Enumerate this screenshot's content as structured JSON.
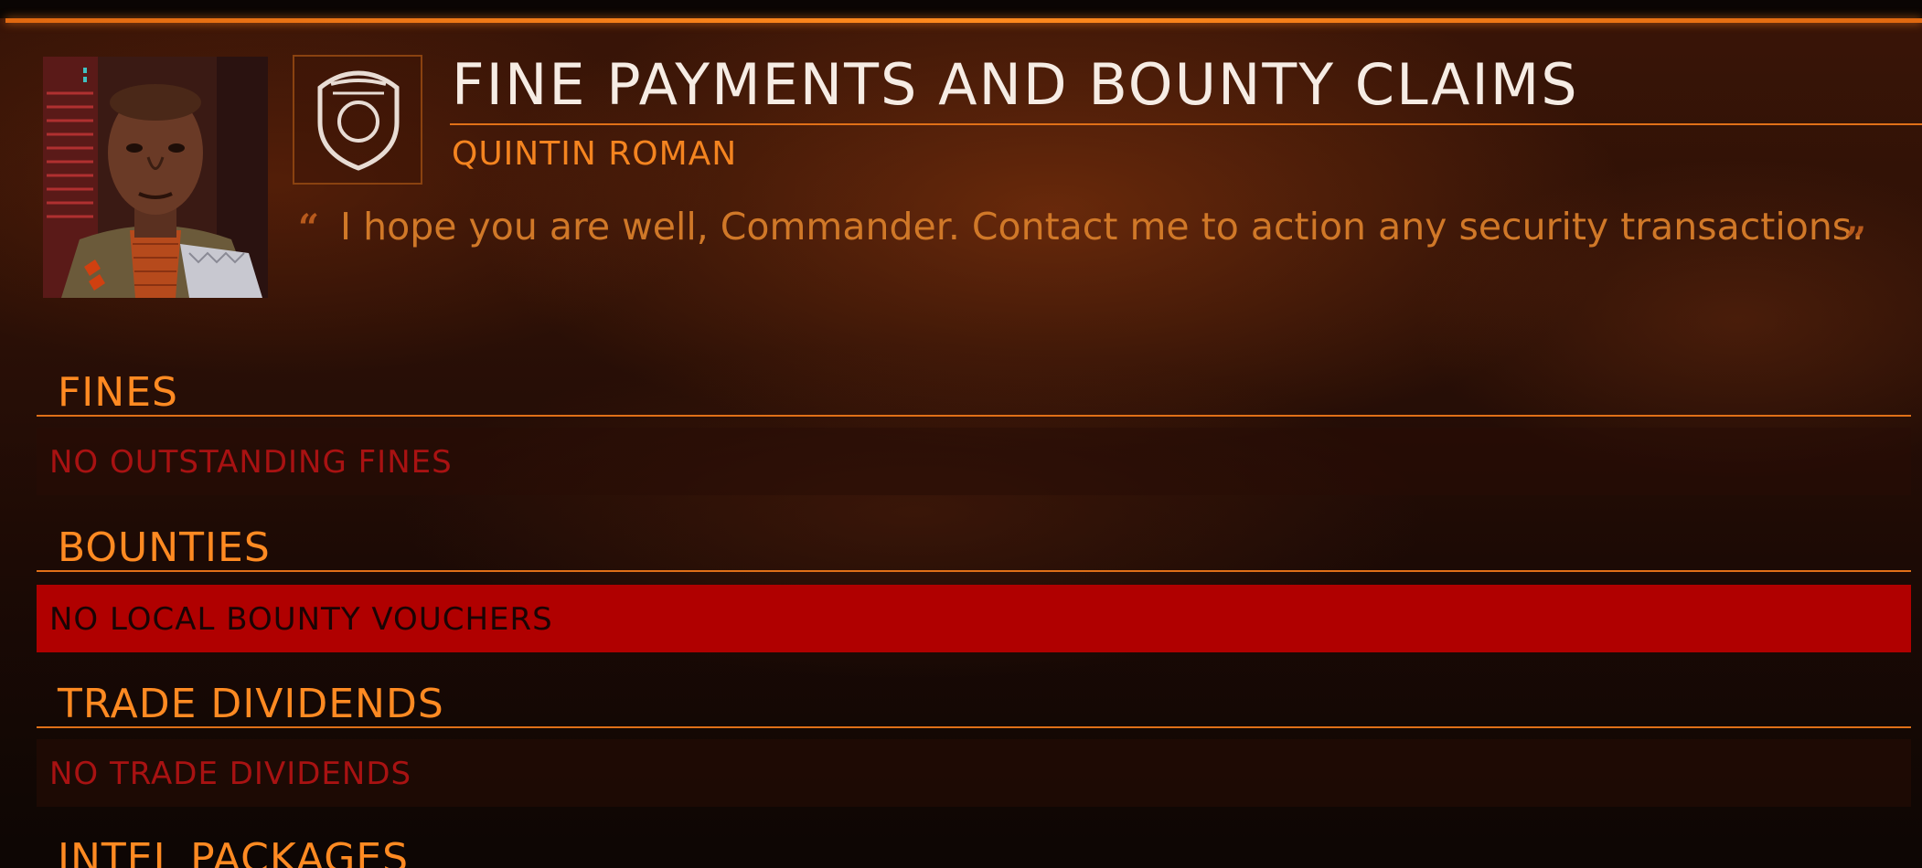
{
  "header": {
    "title": "FINE PAYMENTS AND BOUNTY CLAIMS",
    "contact_name": "QUINTIN ROMAN",
    "quote": "I hope you are well, Commander. Contact me to action any security transactions.",
    "portrait_icon": "contact-portrait",
    "faction_icon": "security-shield-icon"
  },
  "sections": [
    {
      "heading": "FINES",
      "row_text": "NO OUTSTANDING FINES",
      "selected": false
    },
    {
      "heading": "BOUNTIES",
      "row_text": "NO LOCAL BOUNTY VOUCHERS",
      "selected": true
    },
    {
      "heading": "TRADE DIVIDENDS",
      "row_text": "NO TRADE DIVIDENDS",
      "selected": false
    },
    {
      "heading": "INTEL PACKAGES"
    }
  ],
  "colors": {
    "accent": "#ff8a22",
    "selected_row": "#b00000",
    "inactive_text": "#a81212",
    "title_text": "#f6ece4"
  }
}
